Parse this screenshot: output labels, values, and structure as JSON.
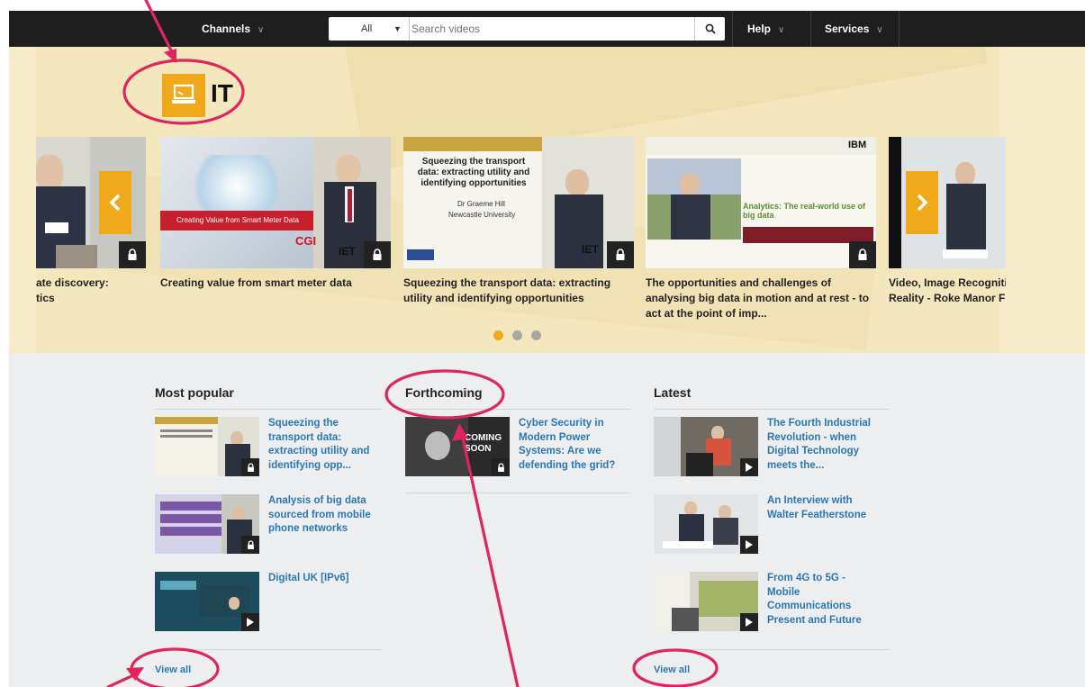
{
  "nav": {
    "channels_label": "Channels",
    "search_scope": "All",
    "search_placeholder": "Search videos",
    "help_label": "Help",
    "services_label": "Services"
  },
  "hero": {
    "channel_title": "IT",
    "cards": [
      {
        "title": "ate discovery: tics"
      },
      {
        "title": "Creating value from smart meter data",
        "slide_text": "Creating Value from Smart Meter Data",
        "brand": "CGI",
        "brand2": "IET"
      },
      {
        "title": "Squeezing the transport data: extracting utility and identifying opportunities",
        "slide_title": "Squeezing the transport data: extracting utility and identifying opportunities",
        "slide_author": "Dr Graeme Hill",
        "slide_org": "Newcastle University",
        "brand": "IET"
      },
      {
        "title": "The opportunities and challenges of analysing big data in motion and at rest - to act at the point of imp...",
        "slide_title": "Analytics: The real-world use of big data",
        "brand": "IBM"
      },
      {
        "title": "Video, Image Recogniti Reality - Roke Manor F"
      }
    ]
  },
  "sections": {
    "popular": {
      "title": "Most popular",
      "items": [
        {
          "title": "Squeezing the transport data: extracting utility and identifying opp..."
        },
        {
          "title": "Analysis of big data sourced from mobile phone networks"
        },
        {
          "title": "Digital UK [IPv6]"
        }
      ],
      "view_all": "View all"
    },
    "forthcoming": {
      "title": "Forthcoming",
      "items": [
        {
          "title": "Cyber Security in Modern Power Systems: Are we defending the grid?",
          "badge": "COMING SOON"
        }
      ]
    },
    "latest": {
      "title": "Latest",
      "items": [
        {
          "title": "The Fourth Industrial Revolution - when Digital Technology meets the..."
        },
        {
          "title": "An Interview with Walter Featherstone"
        },
        {
          "title": "From 4G to 5G - Mobile Communications Present and Future"
        }
      ],
      "view_all": "View all"
    }
  },
  "colors": {
    "accent": "#f0a91b",
    "link": "#2b78b4",
    "annotation": "#e0245e",
    "nav_bg": "#1e1e1e"
  }
}
